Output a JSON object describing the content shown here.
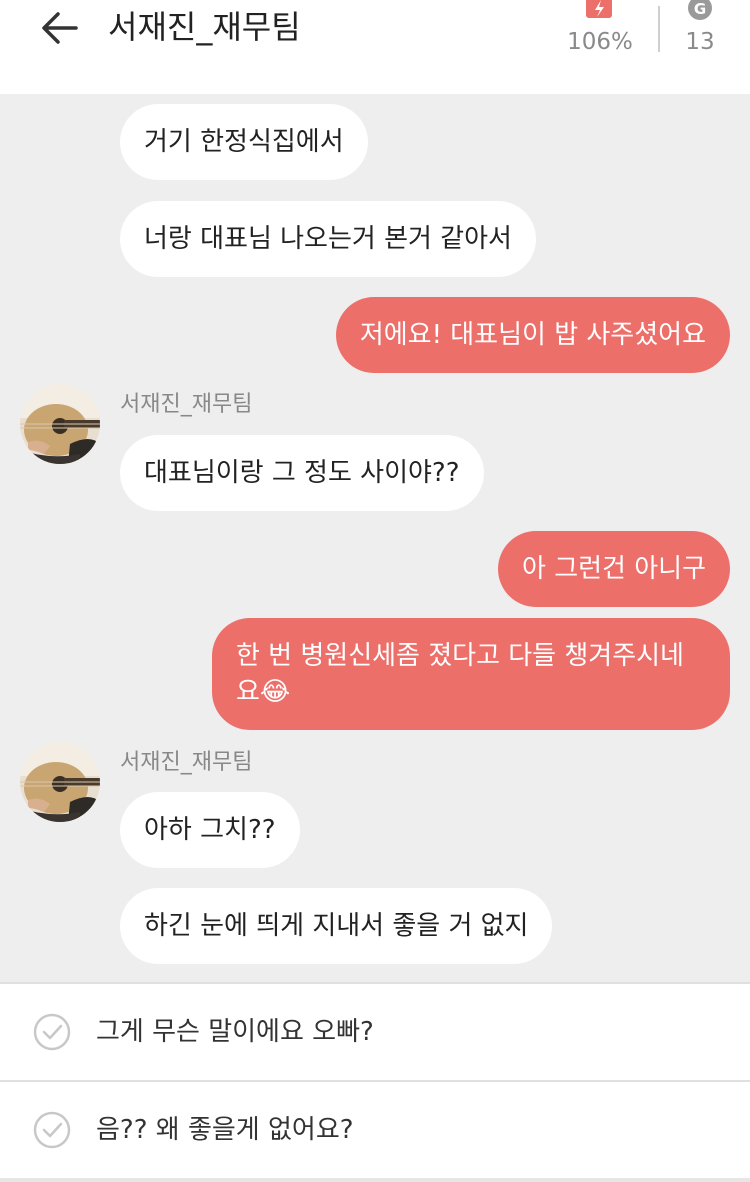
{
  "header": {
    "title": "서재진_재무팀",
    "battery_value": "106%",
    "coin_value": "13",
    "coin_letter": "G"
  },
  "colors": {
    "accent": "#ec6f6a",
    "chat_bg": "#eeeeee",
    "bubble_in": "#ffffff"
  },
  "messages": [
    {
      "from": "them",
      "text": "거기 한정식집에서"
    },
    {
      "from": "them",
      "text": "너랑 대표님 나오는거 본거 같아서"
    },
    {
      "from": "me",
      "text": "저에요! 대표님이 밥 사주셨어요"
    },
    {
      "from": "them",
      "sender": "서재진_재무팀",
      "text": "대표님이랑 그 정도 사이야??"
    },
    {
      "from": "me",
      "text": "아 그런건 아니구"
    },
    {
      "from": "me",
      "line1": "한 번 병원신세좀 졌다고 다들 챙겨주시네",
      "line2": "요",
      "emoji": "😂"
    },
    {
      "from": "them",
      "sender": "서재진_재무팀",
      "text": "아하 그치??"
    },
    {
      "from": "them",
      "text": "하긴 눈에 띄게 지내서 좋을 거 없지"
    }
  ],
  "choices": [
    {
      "label": "그게 무슨 말이에요 오빠?"
    },
    {
      "label": "음?? 왜 좋을게 없어요?"
    }
  ]
}
